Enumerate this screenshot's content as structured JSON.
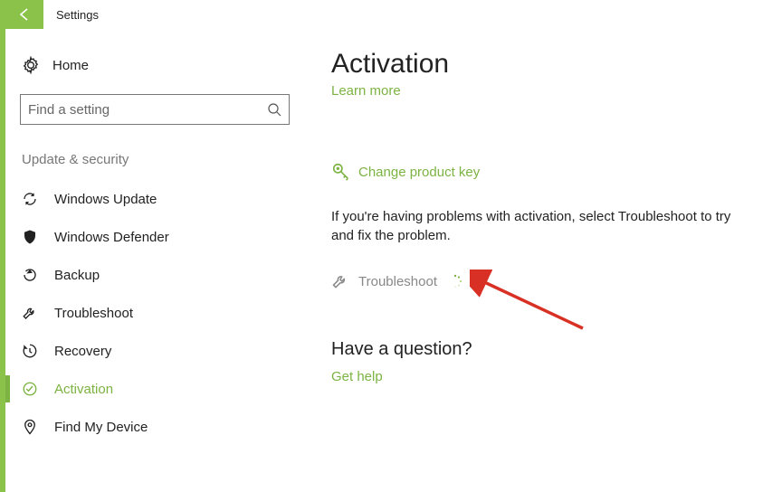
{
  "header": {
    "app_title": "Settings"
  },
  "sidebar": {
    "home_label": "Home",
    "search_placeholder": "Find a setting",
    "section_label": "Update & security",
    "items": [
      {
        "label": "Windows Update"
      },
      {
        "label": "Windows Defender"
      },
      {
        "label": "Backup"
      },
      {
        "label": "Troubleshoot"
      },
      {
        "label": "Recovery"
      },
      {
        "label": "Activation"
      },
      {
        "label": "Find My Device"
      }
    ]
  },
  "main": {
    "title": "Activation",
    "learn_more": "Learn more",
    "change_key": "Change product key",
    "description": "If you're having problems with activation, select Troubleshoot to try and fix the problem.",
    "troubleshoot": "Troubleshoot",
    "question_title": "Have a question?",
    "get_help": "Get help"
  }
}
